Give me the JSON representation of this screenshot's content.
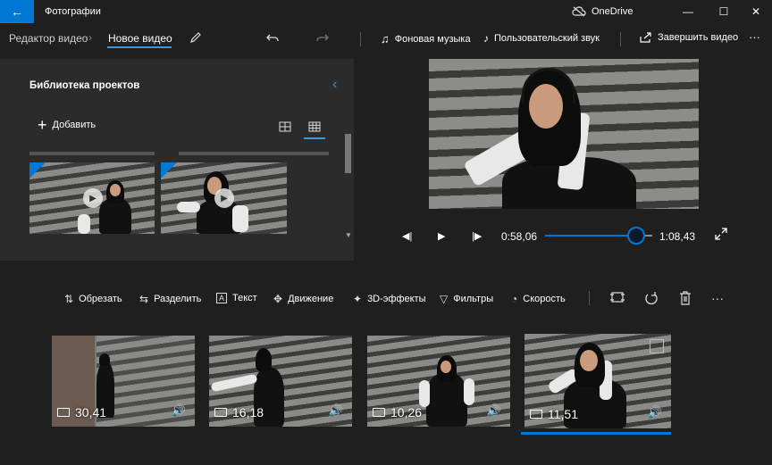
{
  "titlebar": {
    "app_title": "Фотографии",
    "cloud_label": "OneDrive",
    "back_icon": "arrow-left-icon",
    "minimize_glyph": "—",
    "maximize_glyph": "☐",
    "close_glyph": "✕"
  },
  "toolbar": {
    "breadcrumb_parent": "Редактор видео",
    "breadcrumb_current": "Новое видео",
    "bg_music_label": "Фоновая музыка",
    "custom_audio_label": "Пользовательский звук",
    "finish_label": "Завершить видео",
    "more_glyph": "···"
  },
  "library": {
    "title": "Библиотека проектов",
    "add_label": "Добавить"
  },
  "playback": {
    "current_time": "0:58,06",
    "total_time": "1:08,43",
    "progress_fraction": 0.85
  },
  "storyboard": {
    "tools": [
      {
        "label": "Обрезать",
        "icon": "trim-icon"
      },
      {
        "label": "Разделить",
        "icon": "split-icon"
      },
      {
        "label": "Текст",
        "icon": "text-icon"
      },
      {
        "label": "Движение",
        "icon": "motion-icon"
      },
      {
        "label": "3D-эффекты",
        "icon": "3d-effects-icon"
      },
      {
        "label": "Фильтры",
        "icon": "filters-icon"
      },
      {
        "label": "Скорость",
        "icon": "speed-icon"
      }
    ],
    "clips": [
      {
        "duration": "30,41"
      },
      {
        "duration": "16,18"
      },
      {
        "duration": "10,26"
      },
      {
        "duration": "11,51"
      }
    ],
    "more_glyph": "···"
  },
  "colors": {
    "accent": "#0078d4",
    "background": "#1f1f1f",
    "panel": "#2b2b2b"
  }
}
